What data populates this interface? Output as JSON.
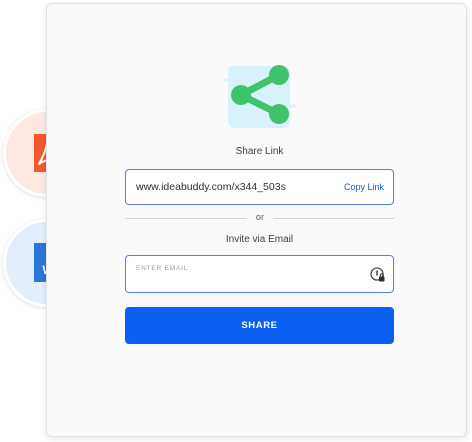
{
  "share_dialog": {
    "share_link_title": "Share Link",
    "link_url": "www.ideabuddy.com/x344_503s",
    "copy_link_label": "Copy Link",
    "divider_text": "or",
    "invite_title": "Invite via Email",
    "email_placeholder": "ENTER EMAIL",
    "share_button_label": "SHARE"
  },
  "file_badges": {
    "word_letter": "W"
  },
  "colors": {
    "accent_blue": "#0a60f0",
    "share_green": "#3fc36b",
    "pdf_orange": "#f4572d",
    "word_blue": "#2a78d6"
  },
  "icons": [
    "share-icon",
    "pdf-file-icon",
    "word-file-icon",
    "password-manager-icon"
  ]
}
